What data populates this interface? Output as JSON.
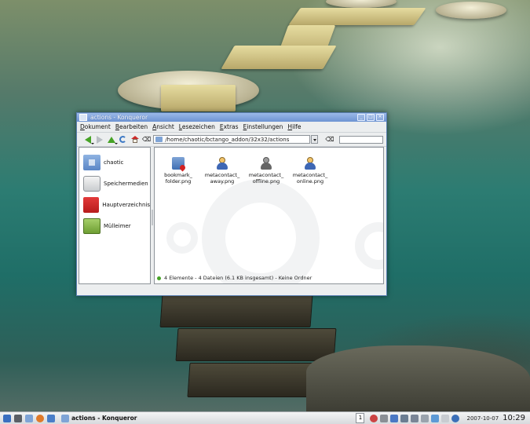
{
  "window": {
    "title": "actions - Konqueror",
    "controls": {
      "minimize": "_",
      "maximize": "□",
      "close": "×"
    }
  },
  "menu": [
    "Dokument",
    "Bearbeiten",
    "Ansicht",
    "Lesezeichen",
    "Extras",
    "Einstellungen",
    "Hilfe"
  ],
  "toolbar": {
    "location_value": "/home/chaotic/bctango_addon/32x32/actions",
    "icons": [
      "back-icon",
      "forward-icon",
      "up-icon",
      "reload-icon",
      "home-icon",
      "clear-location-icon",
      "go-icon"
    ],
    "search_value": ""
  },
  "sidebar": {
    "items": [
      {
        "label": "chaotic",
        "icon": "home-folder-icon"
      },
      {
        "label": "Speichermedien",
        "icon": "drive-icon"
      },
      {
        "label": "Hauptverzeichnis",
        "icon": "red-folder-icon"
      },
      {
        "label": "Mülleimer",
        "icon": "trash-icon"
      }
    ]
  },
  "files": [
    {
      "line1": "bookmark_",
      "line2": "folder.png",
      "icon": "bookmark-folder-icon"
    },
    {
      "line1": "metacontact_",
      "line2": "away.png",
      "icon": "contact-away-icon"
    },
    {
      "line1": "metacontact_",
      "line2": "offline.png",
      "icon": "contact-offline-icon"
    },
    {
      "line1": "metacontact_",
      "line2": "online.png",
      "icon": "contact-online-icon"
    }
  ],
  "status": "4 Elemente - 4 Dateien (6.1 KB insgesamt) - Keine Ordner",
  "taskbar": {
    "task_label": "actions - Konqueror",
    "pager": "1",
    "date": "2007-10-07",
    "time": "10:29"
  },
  "colors": {
    "titlebar": "#7fa3dd",
    "accent_green": "#46a326",
    "folder_blue": "#5b86c6"
  }
}
